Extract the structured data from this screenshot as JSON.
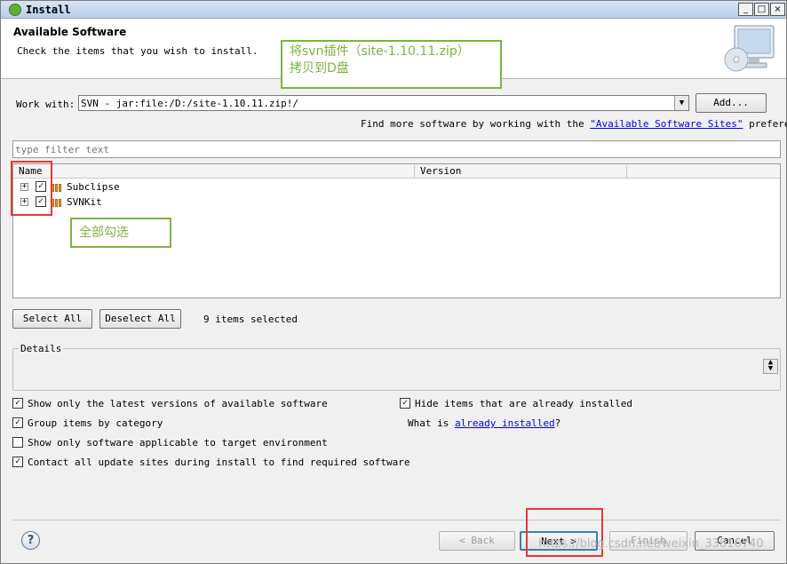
{
  "window": {
    "title": "Install",
    "minimize": "_",
    "maximize": "□",
    "close": "×"
  },
  "header": {
    "title": "Available Software",
    "description": "Check the items that you wish to install."
  },
  "annotation_top": {
    "line1": "将svn插件（site-1.10.11.zip）",
    "line2": "拷贝到D盘"
  },
  "annotation_mid": "全部勾选",
  "work_with": {
    "label": "Work with:",
    "value": "SVN - jar:file:/D:/site-1.10.11.zip!/",
    "add_button": "Add..."
  },
  "find_more": {
    "prefix": "Find more software by working with the ",
    "link": "\"Available Software Sites\"",
    "suffix": " preferences."
  },
  "filter": {
    "placeholder": "type filter text"
  },
  "tree": {
    "columns": [
      "Name",
      "Version"
    ],
    "rows": [
      {
        "label": "Subclipse",
        "checked": true
      },
      {
        "label": "SVNKit",
        "checked": true
      }
    ]
  },
  "selection": {
    "select_all": "Select All",
    "deselect_all": "Deselect All",
    "status": "9 items selected"
  },
  "details": {
    "label": "Details"
  },
  "options": {
    "latest_versions": {
      "label": "Show only the latest versions of available software",
      "checked": true
    },
    "group_by_category": {
      "label": "Group items by category",
      "checked": true
    },
    "applicable_only": {
      "label": "Show only software applicable to target environment",
      "checked": false
    },
    "contact_sites": {
      "label": "Contact all update sites during install to find required software",
      "checked": true
    },
    "hide_installed": {
      "label": "Hide items that are already installed",
      "checked": true
    },
    "what_is": {
      "prefix": "What is ",
      "link": "already installed",
      "suffix": "?"
    }
  },
  "footer": {
    "help": "?",
    "back": "< Back",
    "next": "Next >",
    "finish": "Finish",
    "cancel": "Cancel"
  },
  "watermark": "https://blog.csdn.net/weixin_33816740",
  "colors": {
    "annotation": "#7cb342",
    "highlight": "#e53935",
    "link": "#0000ee",
    "titlebar": "#c8d8ee"
  }
}
